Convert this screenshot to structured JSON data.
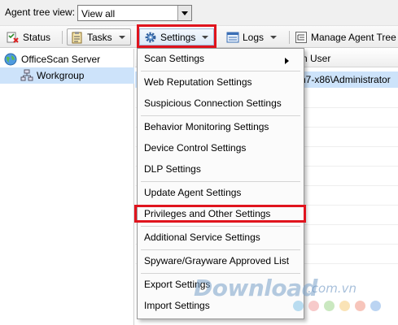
{
  "filter_bar": {
    "label": "Agent tree view:",
    "select_value": "View all"
  },
  "toolbar": {
    "status_label": "Status",
    "tasks_label": "Tasks",
    "settings_label": "Settings",
    "logs_label": "Logs",
    "manage_label": "Manage Agent Tree"
  },
  "tree": {
    "server_label": "OfficeScan Server",
    "workgroup_label": "Workgroup"
  },
  "grid": {
    "column_header": "n User",
    "selected_row_user": "n7-x86\\Administrator"
  },
  "menu": {
    "items": [
      "Scan Settings",
      "Web Reputation Settings",
      "Suspicious Connection Settings",
      "Behavior Monitoring Settings",
      "Device Control Settings",
      "DLP Settings",
      "Update Agent Settings",
      "Privileges and Other Settings",
      "Additional Service Settings",
      "Spyware/Grayware Approved List",
      "Export Settings",
      "Import Settings"
    ]
  },
  "watermark": {
    "text": "Download",
    "tld": ".com.vn"
  },
  "colors": {
    "highlight_red": "#e0141e",
    "selection_blue": "#cde3fa"
  }
}
